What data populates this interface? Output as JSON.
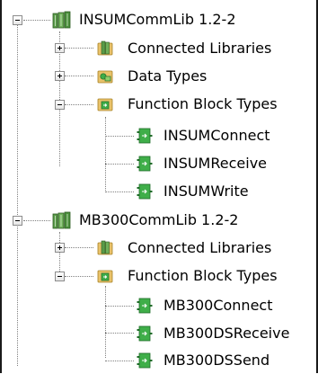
{
  "tree": {
    "lib1": {
      "name": "INSUMCommLib 1.2-2",
      "connected_libraries": "Connected Libraries",
      "data_types": "Data Types",
      "function_block_types": "Function Block Types",
      "fb_items": [
        "INSUMConnect",
        "INSUMReceive",
        "INSUMWrite"
      ]
    },
    "lib2": {
      "name": "MB300CommLib 1.2-2",
      "connected_libraries": "Connected Libraries",
      "function_block_types": "Function Block Types",
      "fb_items": [
        "MB300Connect",
        "MB300DSReceive",
        "MB300DSSend"
      ]
    }
  },
  "icons": {
    "library": "library-books-icon",
    "connected_libraries": "connected-libraries-icon",
    "data_types": "data-types-icon",
    "function_block_types": "function-block-types-icon",
    "function_block": "function-block-icon"
  },
  "colors": {
    "library_green": "#4a8f3c",
    "folder_yellow": "#e8c26a",
    "fb_green": "#3fae49"
  }
}
